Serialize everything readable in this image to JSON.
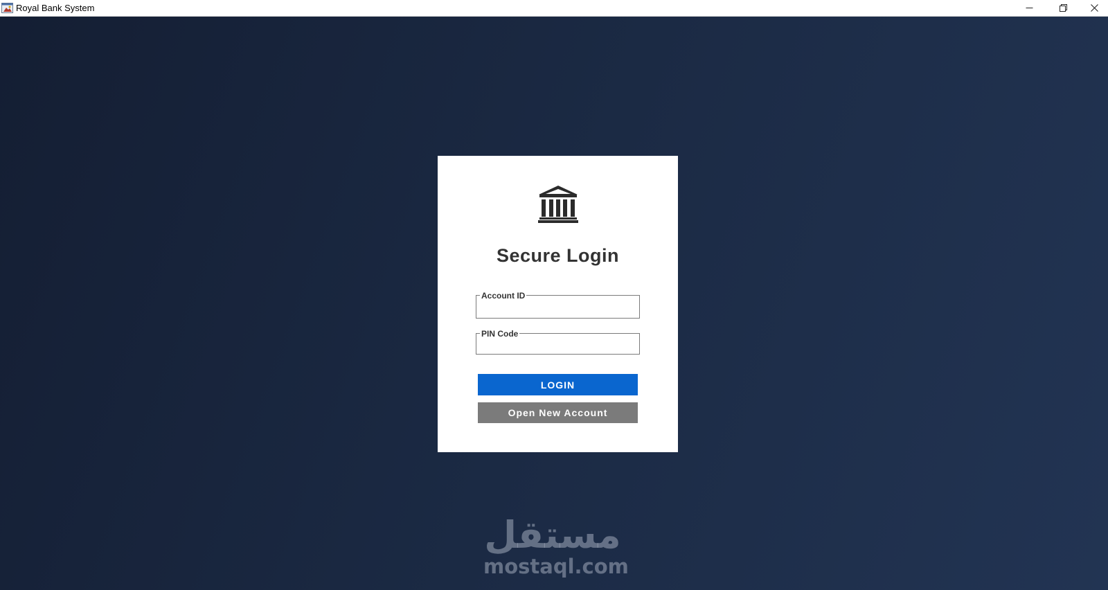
{
  "window": {
    "title": "Royal Bank System",
    "app_icon": "app-window-icon",
    "controls": {
      "minimize_icon": "minimize-icon",
      "maximize_icon": "restore-icon",
      "close_icon": "close-icon"
    }
  },
  "login_card": {
    "icon": "bank-building-icon",
    "title": "Secure Login",
    "account_id": {
      "label": "Account ID",
      "value": "",
      "placeholder": ""
    },
    "pin_code": {
      "label": "PIN Code",
      "value": "",
      "placeholder": ""
    },
    "login_button": "LOGIN",
    "open_account_button": "Open New Account"
  },
  "colors": {
    "background_start": "#141e33",
    "background_end": "#223453",
    "card": "#ffffff",
    "login_button": "#0a66cf",
    "open_account_button": "#7b7b7b",
    "title_text": "#333333"
  },
  "watermark": {
    "arabic": "مستقل",
    "latin": "mostaql.com"
  }
}
